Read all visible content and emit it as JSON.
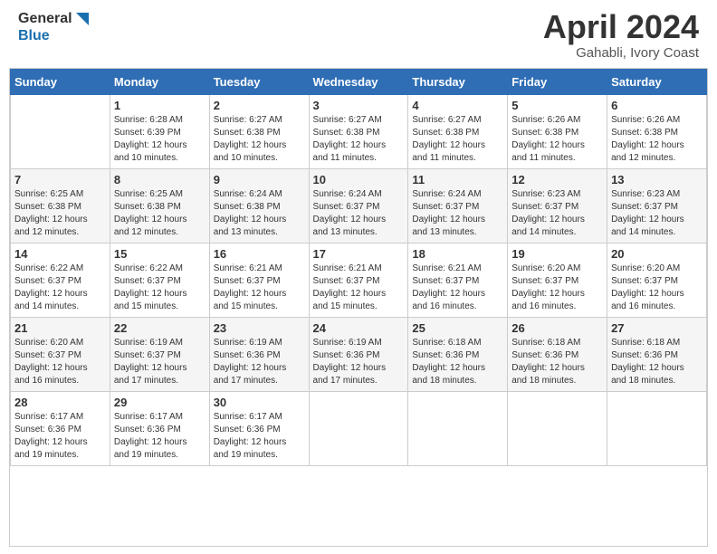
{
  "header": {
    "logo_line1": "General",
    "logo_line2": "Blue",
    "title": "April 2024",
    "location": "Gahabli, Ivory Coast"
  },
  "weekdays": [
    "Sunday",
    "Monday",
    "Tuesday",
    "Wednesday",
    "Thursday",
    "Friday",
    "Saturday"
  ],
  "weeks": [
    [
      {
        "day": "",
        "info": ""
      },
      {
        "day": "1",
        "info": "Sunrise: 6:28 AM\nSunset: 6:39 PM\nDaylight: 12 hours\nand 10 minutes."
      },
      {
        "day": "2",
        "info": "Sunrise: 6:27 AM\nSunset: 6:38 PM\nDaylight: 12 hours\nand 10 minutes."
      },
      {
        "day": "3",
        "info": "Sunrise: 6:27 AM\nSunset: 6:38 PM\nDaylight: 12 hours\nand 11 minutes."
      },
      {
        "day": "4",
        "info": "Sunrise: 6:27 AM\nSunset: 6:38 PM\nDaylight: 12 hours\nand 11 minutes."
      },
      {
        "day": "5",
        "info": "Sunrise: 6:26 AM\nSunset: 6:38 PM\nDaylight: 12 hours\nand 11 minutes."
      },
      {
        "day": "6",
        "info": "Sunrise: 6:26 AM\nSunset: 6:38 PM\nDaylight: 12 hours\nand 12 minutes."
      }
    ],
    [
      {
        "day": "7",
        "info": "Sunrise: 6:25 AM\nSunset: 6:38 PM\nDaylight: 12 hours\nand 12 minutes."
      },
      {
        "day": "8",
        "info": "Sunrise: 6:25 AM\nSunset: 6:38 PM\nDaylight: 12 hours\nand 12 minutes."
      },
      {
        "day": "9",
        "info": "Sunrise: 6:24 AM\nSunset: 6:38 PM\nDaylight: 12 hours\nand 13 minutes."
      },
      {
        "day": "10",
        "info": "Sunrise: 6:24 AM\nSunset: 6:37 PM\nDaylight: 12 hours\nand 13 minutes."
      },
      {
        "day": "11",
        "info": "Sunrise: 6:24 AM\nSunset: 6:37 PM\nDaylight: 12 hours\nand 13 minutes."
      },
      {
        "day": "12",
        "info": "Sunrise: 6:23 AM\nSunset: 6:37 PM\nDaylight: 12 hours\nand 14 minutes."
      },
      {
        "day": "13",
        "info": "Sunrise: 6:23 AM\nSunset: 6:37 PM\nDaylight: 12 hours\nand 14 minutes."
      }
    ],
    [
      {
        "day": "14",
        "info": "Sunrise: 6:22 AM\nSunset: 6:37 PM\nDaylight: 12 hours\nand 14 minutes."
      },
      {
        "day": "15",
        "info": "Sunrise: 6:22 AM\nSunset: 6:37 PM\nDaylight: 12 hours\nand 15 minutes."
      },
      {
        "day": "16",
        "info": "Sunrise: 6:21 AM\nSunset: 6:37 PM\nDaylight: 12 hours\nand 15 minutes."
      },
      {
        "day": "17",
        "info": "Sunrise: 6:21 AM\nSunset: 6:37 PM\nDaylight: 12 hours\nand 15 minutes."
      },
      {
        "day": "18",
        "info": "Sunrise: 6:21 AM\nSunset: 6:37 PM\nDaylight: 12 hours\nand 16 minutes."
      },
      {
        "day": "19",
        "info": "Sunrise: 6:20 AM\nSunset: 6:37 PM\nDaylight: 12 hours\nand 16 minutes."
      },
      {
        "day": "20",
        "info": "Sunrise: 6:20 AM\nSunset: 6:37 PM\nDaylight: 12 hours\nand 16 minutes."
      }
    ],
    [
      {
        "day": "21",
        "info": "Sunrise: 6:20 AM\nSunset: 6:37 PM\nDaylight: 12 hours\nand 16 minutes."
      },
      {
        "day": "22",
        "info": "Sunrise: 6:19 AM\nSunset: 6:37 PM\nDaylight: 12 hours\nand 17 minutes."
      },
      {
        "day": "23",
        "info": "Sunrise: 6:19 AM\nSunset: 6:36 PM\nDaylight: 12 hours\nand 17 minutes."
      },
      {
        "day": "24",
        "info": "Sunrise: 6:19 AM\nSunset: 6:36 PM\nDaylight: 12 hours\nand 17 minutes."
      },
      {
        "day": "25",
        "info": "Sunrise: 6:18 AM\nSunset: 6:36 PM\nDaylight: 12 hours\nand 18 minutes."
      },
      {
        "day": "26",
        "info": "Sunrise: 6:18 AM\nSunset: 6:36 PM\nDaylight: 12 hours\nand 18 minutes."
      },
      {
        "day": "27",
        "info": "Sunrise: 6:18 AM\nSunset: 6:36 PM\nDaylight: 12 hours\nand 18 minutes."
      }
    ],
    [
      {
        "day": "28",
        "info": "Sunrise: 6:17 AM\nSunset: 6:36 PM\nDaylight: 12 hours\nand 19 minutes."
      },
      {
        "day": "29",
        "info": "Sunrise: 6:17 AM\nSunset: 6:36 PM\nDaylight: 12 hours\nand 19 minutes."
      },
      {
        "day": "30",
        "info": "Sunrise: 6:17 AM\nSunset: 6:36 PM\nDaylight: 12 hours\nand 19 minutes."
      },
      {
        "day": "",
        "info": ""
      },
      {
        "day": "",
        "info": ""
      },
      {
        "day": "",
        "info": ""
      },
      {
        "day": "",
        "info": ""
      }
    ]
  ]
}
